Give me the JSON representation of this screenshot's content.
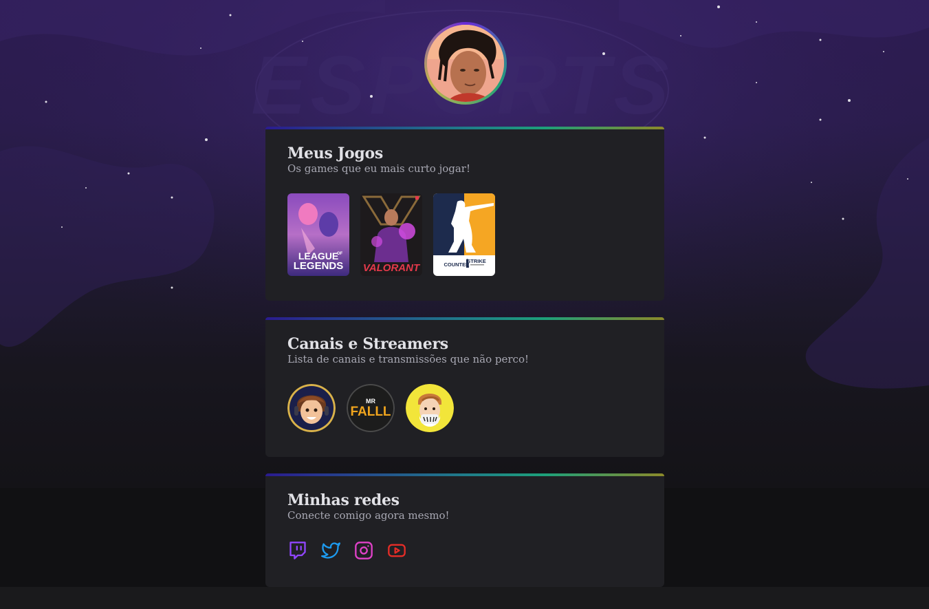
{
  "profile": {
    "avatar_alt": "profile-photo"
  },
  "background": {
    "logo_text": "ESPORTS"
  },
  "games_section": {
    "title": "Meus Jogos",
    "subtitle": "Os games que eu mais curto jogar!",
    "games": [
      {
        "name": "League of Legends",
        "logo_line1": "LEAGUE",
        "logo_of": "OF",
        "logo_line2": "LEGENDS"
      },
      {
        "name": "Valorant",
        "logo": "VALORANT"
      },
      {
        "name": "Counter Strike",
        "logo_left": "COUNTER",
        "logo_right": "STRIKE"
      }
    ]
  },
  "channels_section": {
    "title": "Canais e Streamers",
    "subtitle": "Lista de canais e transmissões que não perco!",
    "channels": [
      {
        "name": "streamer-1"
      },
      {
        "name": "Mr Falll",
        "logo_small": "MR",
        "logo_big": "FALLL"
      },
      {
        "name": "streamer-3"
      }
    ]
  },
  "social_section": {
    "title": "Minhas redes",
    "subtitle": "Conecte comigo agora mesmo!",
    "links": [
      {
        "name": "twitch",
        "icon": "twitch-icon",
        "color": "#9146ff"
      },
      {
        "name": "twitter",
        "icon": "twitter-icon",
        "color": "#1d9bf0"
      },
      {
        "name": "instagram",
        "icon": "instagram-icon",
        "color": "#e041c8"
      },
      {
        "name": "youtube",
        "icon": "youtube-icon",
        "color": "#e52d27"
      }
    ]
  },
  "colors": {
    "card_bg": "#202024",
    "title": "#e1e1e6",
    "subtitle": "#a8a8b3",
    "page_bg": "#121214"
  }
}
